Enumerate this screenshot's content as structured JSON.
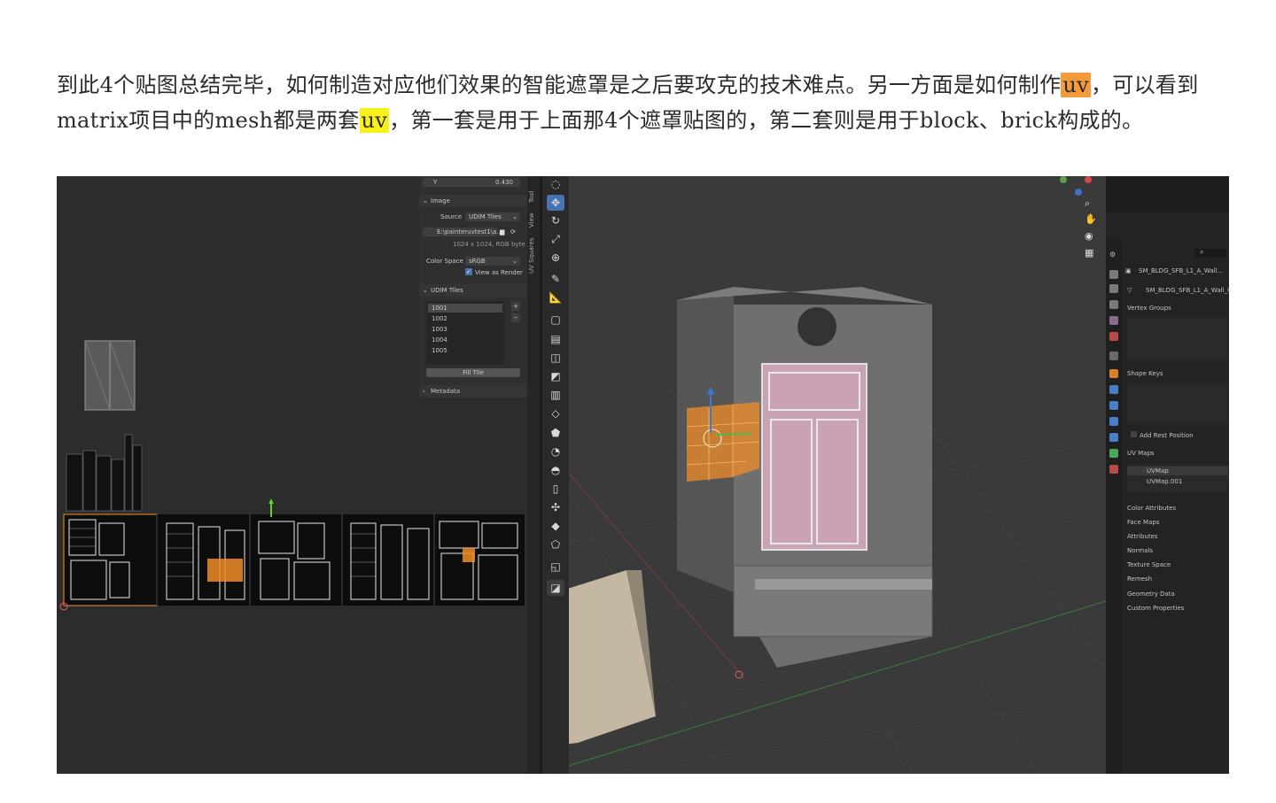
{
  "article": {
    "part1": "到此4个贴图总结完毕，如何制造对应他们效果的智能遮罩是之后要攻克的技术难点。另一方面是如何制作",
    "uv1": "uv",
    "part2": "，可以看到matrix项目中的mesh都是两套",
    "uv2": "uv",
    "part3": "，第一套是用于上面那4个遮罩贴图的，第二套则是用于block、brick构成的。"
  },
  "image_panel": {
    "y_label": "Y",
    "y_value": "0.430",
    "image_header": "Image",
    "source_label": "Source",
    "source_value": "UDIM Tiles",
    "file_path": "E:\\painteruvtest1\\a...",
    "resolution": "1024 x 1024,  RGB byte",
    "color_space_label": "Color Space",
    "color_space_value": "sRGB",
    "view_as_render": "View as Render",
    "udim_header": "UDIM Tiles",
    "tiles": [
      "1001",
      "1002",
      "1003",
      "1004",
      "1005"
    ],
    "fill_tile": "Fill Tile",
    "metadata": "Metadata"
  },
  "side_tabs": [
    "Tool",
    "View",
    "UV Squares"
  ],
  "properties": {
    "object_name": "SM_BLDG_SFB_L1_A_Wall...",
    "mesh_name": "SM_BLDG_SFB_L1_A_Wall_04",
    "vertex_groups": "Vertex Groups",
    "shape_keys": "Shape Keys",
    "add_rest_position": "Add Rest Position",
    "uv_maps": "UV Maps",
    "uv_map_items": [
      "UVMap",
      "UVMap.001"
    ],
    "sections": [
      "Color Attributes",
      "Face Maps",
      "Attributes",
      "Normals",
      "Texture Space",
      "Remesh",
      "Geometry Data",
      "Custom Properties"
    ]
  },
  "colors": {
    "highlight_orange": "#f59a3b",
    "highlight_yellow": "#f7f01a",
    "selection_orange": "#f28c28",
    "active_tool_blue": "#4772b3",
    "window_pink": "#c9a3b5"
  },
  "icons": [
    "move-icon",
    "rotate-icon",
    "scale-icon",
    "transform-icon",
    "annotate-icon",
    "measure-icon",
    "add-cube-icon",
    "extrude-icon",
    "inset-icon",
    "bevel-icon",
    "loop-cut-icon",
    "knife-icon",
    "poly-build-icon",
    "spin-icon",
    "smooth-icon",
    "edge-slide-icon",
    "shrink-icon",
    "shear-icon",
    "rip-icon",
    "cursor-icon",
    "zoom-icon",
    "hand-icon",
    "camera-icon",
    "grid-icon",
    "search-icon"
  ]
}
